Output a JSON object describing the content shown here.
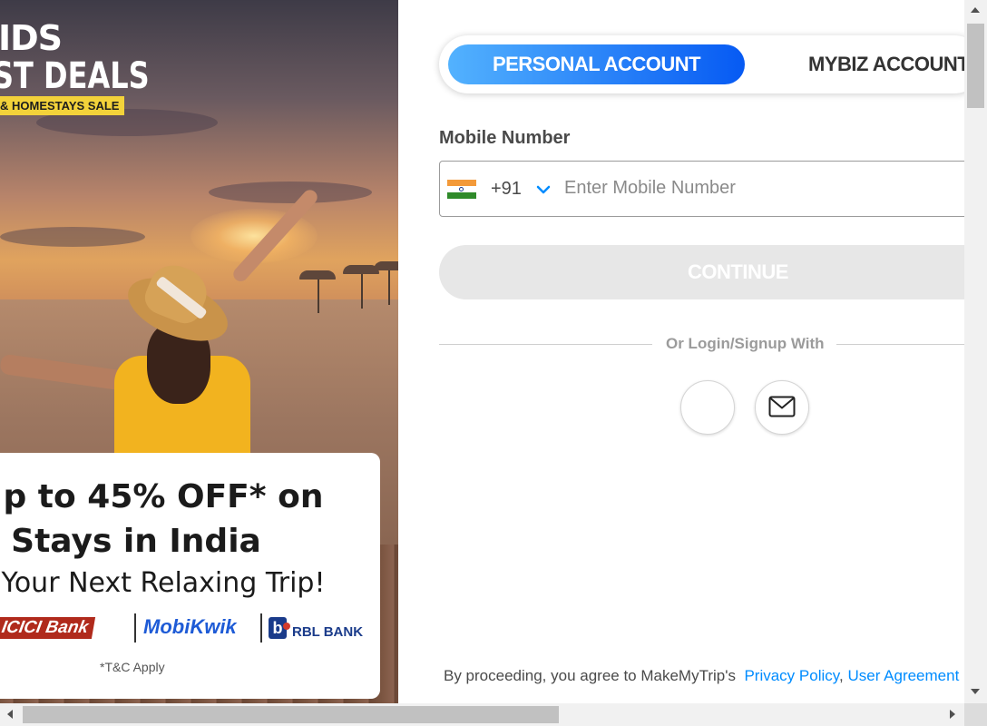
{
  "promo": {
    "brand_line1": "IDS",
    "brand_line2": "ST DEALS",
    "brand_tag": "& HOMESTAYS SALE",
    "headline_line1": "p to 45% OFF* on",
    "headline_line2": "Stays in India",
    "headline_line3": "Your Next Relaxing Trip!",
    "banks": [
      "ICICI Bank",
      "MobiKwik",
      "RBL BANK"
    ],
    "rbl_mark": "b",
    "tnc": "*T&C Apply"
  },
  "account_toggle": {
    "personal_label": "PERSONAL ACCOUNT",
    "mybiz_label": "MYBIZ ACCOUNT",
    "active": "PERSONAL ACCOUNT"
  },
  "login": {
    "mobile_label": "Mobile Number",
    "country_code": "+91",
    "country_flag": "india-flag",
    "mobile_value": "",
    "mobile_placeholder": "Enter Mobile Number",
    "continue_label": "CONTINUE",
    "or_text": "Or Login/Signup With",
    "social_options": [
      "google-icon",
      "email-icon"
    ]
  },
  "legal": {
    "prefix": "By proceeding, you agree to MakeMyTrip's",
    "privacy_link": "Privacy Policy",
    "separator": ",",
    "agreement_link": "User Agreement"
  },
  "colors": {
    "accent_start": "#53b2fe",
    "accent_end": "#065af3",
    "link": "#008cff",
    "continue_disabled": "#e7e7e7"
  }
}
